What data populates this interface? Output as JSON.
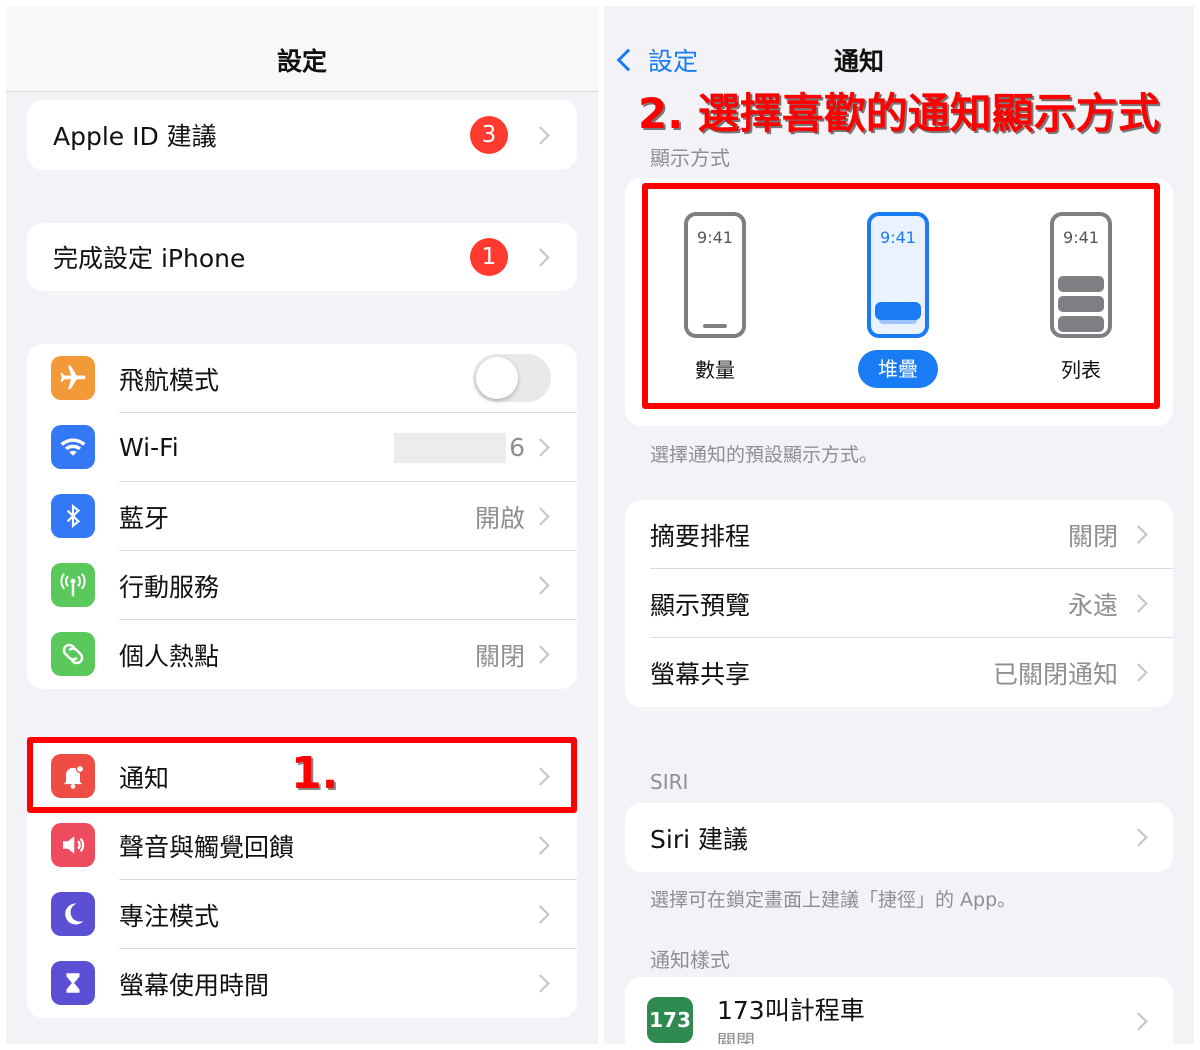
{
  "left": {
    "nav_title": "設定",
    "apple_id_suggestion": {
      "label": "Apple ID 建議",
      "badge": "3"
    },
    "finish_setup": {
      "label": "完成設定 iPhone",
      "badge": "1"
    },
    "connectivity": [
      {
        "label": "飛航模式",
        "value": "",
        "icon": "airplane-icon",
        "color": "#f19a37"
      },
      {
        "label": "Wi-Fi",
        "value": "6",
        "icon": "wifi-icon",
        "color": "#3478f6"
      },
      {
        "label": "藍牙",
        "value": "開啟",
        "icon": "bluetooth-icon",
        "color": "#3478f6"
      },
      {
        "label": "行動服務",
        "value": "",
        "icon": "antenna-icon",
        "color": "#5ac85a"
      },
      {
        "label": "個人熱點",
        "value": "關閉",
        "icon": "hotspot-icon",
        "color": "#5ac85a"
      }
    ],
    "system": [
      {
        "label": "通知",
        "icon": "bell-icon",
        "color": "#ee4c44"
      },
      {
        "label": "聲音與觸覺回饋",
        "icon": "speaker-icon",
        "color": "#ee4c5e"
      },
      {
        "label": "專注模式",
        "icon": "moon-icon",
        "color": "#5b4fd3"
      },
      {
        "label": "螢幕使用時間",
        "icon": "hourglass-icon",
        "color": "#5b4fd3"
      }
    ],
    "step_marker": "1."
  },
  "right": {
    "back_label": "設定",
    "nav_title": "通知",
    "step_marker": "2. 選擇喜歡的通知顯示方式",
    "display_section_header": "顯示方式",
    "display_options": [
      {
        "label": "數量",
        "time": "9:41"
      },
      {
        "label": "堆疊",
        "time": "9:41"
      },
      {
        "label": "列表",
        "time": "9:41"
      }
    ],
    "display_footnote": "選擇通知的預設顯示方式。",
    "settings": [
      {
        "label": "摘要排程",
        "value": "關閉"
      },
      {
        "label": "顯示預覽",
        "value": "永遠"
      },
      {
        "label": "螢幕共享",
        "value": "已關閉通知"
      }
    ],
    "siri_header": "SIRI",
    "siri_row": "Siri 建議",
    "siri_footnote": "選擇可在鎖定畫面上建議「捷徑」的 App。",
    "notification_style_header": "通知樣式",
    "app_row": {
      "name": "173叫計程車",
      "sub": "關閉",
      "icon_text": "173"
    }
  },
  "colors": {
    "accent": "#1a7cf5",
    "badge": "#ff3b30",
    "highlight": "#ff0000"
  }
}
